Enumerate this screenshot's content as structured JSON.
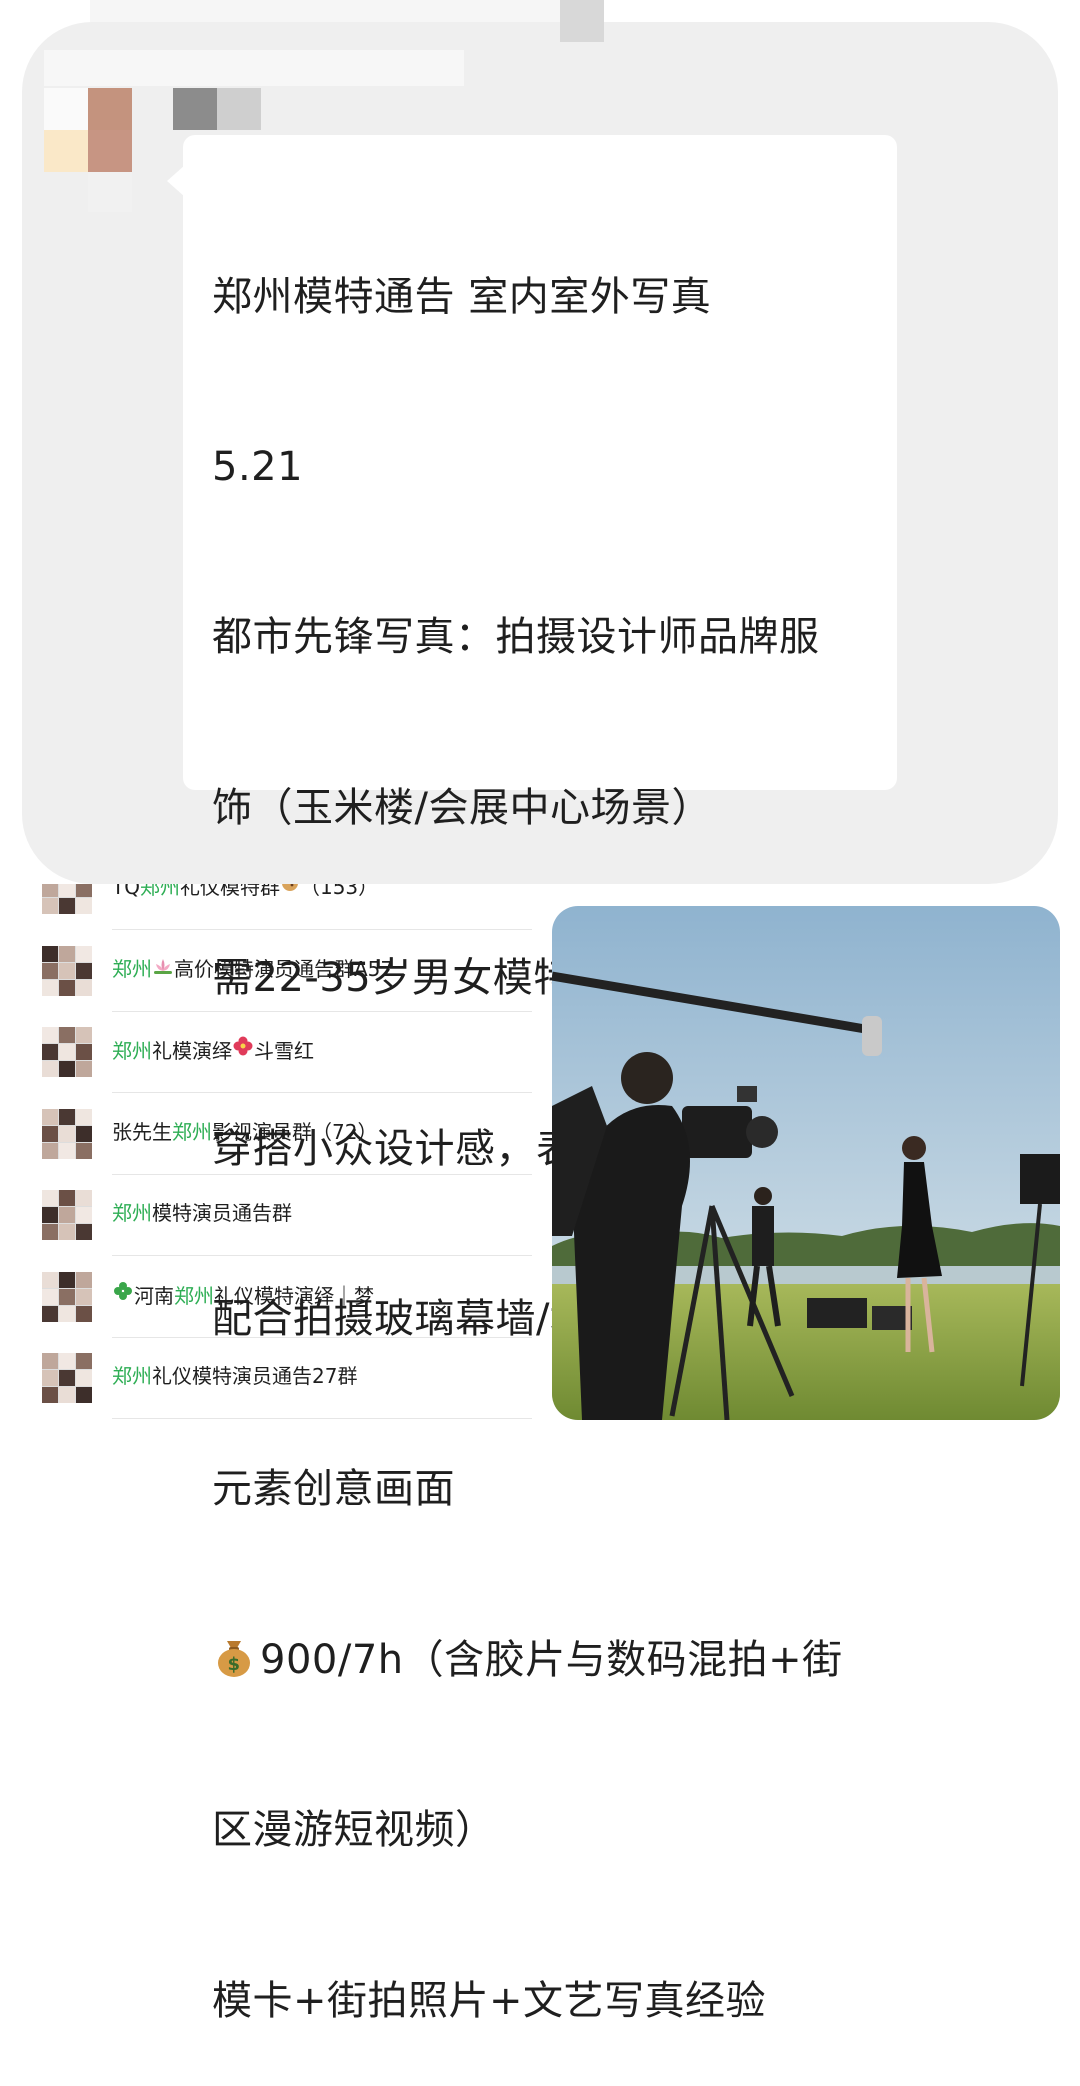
{
  "message": {
    "lines": [
      "郑州模特通告 室内室外写真",
      "5.21",
      "都市先锋写真：拍摄设计师品牌服",
      "饰（玉米楼/会展中心场景）",
      "需22-35岁男女模特，身高不限，",
      "穿搭小众设计感，表情自然灵动",
      "配合拍摄玻璃幕墙/地铁口等现代",
      "元素创意画面",
      "900/7h（含胶片与数码混拍+街",
      "区漫游短视频）",
      "模卡+街拍照片+文艺写真经验"
    ],
    "pay_icon": "money-bag-icon"
  },
  "groups": [
    {
      "parts": [
        "TQ",
        "郑州",
        "礼仪模特群",
        "",
        "（153）"
      ],
      "emoji": "cookie-icon"
    },
    {
      "parts": [
        "",
        "郑州",
        "",
        "高价模特演员通告群A57",
        ""
      ],
      "emoji": "lotus-icon"
    },
    {
      "parts": [
        "",
        "郑州",
        "礼模演绎",
        "斗雪红",
        ""
      ],
      "emoji": "hibiscus-icon"
    },
    {
      "parts": [
        "张先生",
        "郑州",
        "影视演员群（72）",
        "",
        ""
      ],
      "emoji": ""
    },
    {
      "parts": [
        "",
        "郑州",
        "模特演员通告群",
        "",
        ""
      ],
      "emoji": ""
    },
    {
      "parts": [
        "河南",
        "郑州",
        "礼仪模特演绎｜梦",
        "",
        ""
      ],
      "emoji": "clover-icon"
    },
    {
      "parts": [
        "",
        "郑州",
        "礼仪模特演员通告27群",
        "",
        ""
      ],
      "emoji": ""
    }
  ],
  "colors": {
    "card_bg": "#efefef",
    "bubble_bg": "#ffffff",
    "highlight": "#2fae55"
  },
  "photo": {
    "subject": "film-set-photo"
  }
}
